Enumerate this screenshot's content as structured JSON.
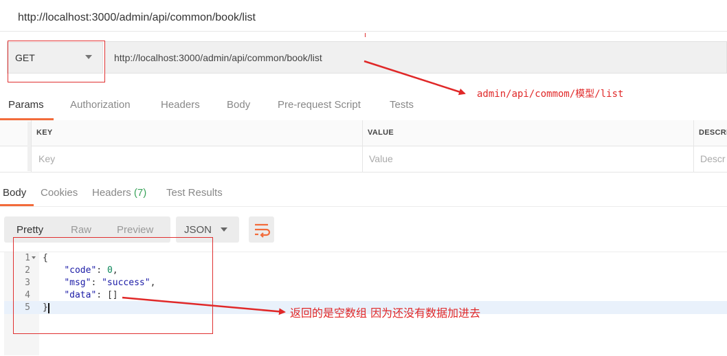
{
  "title": "http://localhost:3000/admin/api/common/book/list",
  "request": {
    "method": "GET",
    "url": "http://localhost:3000/admin/api/common/book/list"
  },
  "request_tabs": [
    {
      "label": "Params",
      "active": true
    },
    {
      "label": "Authorization"
    },
    {
      "label": "Headers"
    },
    {
      "label": "Body"
    },
    {
      "label": "Pre-request Script"
    },
    {
      "label": "Tests"
    }
  ],
  "params_table": {
    "headers": [
      "KEY",
      "VALUE",
      "DESCRI"
    ],
    "placeholders": [
      "Key",
      "Value",
      "Descr"
    ]
  },
  "response_tabs": {
    "body": "Body",
    "cookies": "Cookies",
    "headers": "Headers",
    "headers_count": "(7)",
    "test_results": "Test Results"
  },
  "view_modes": [
    "Pretty",
    "Raw",
    "Preview"
  ],
  "format": "JSON",
  "wrap_icon": "wrap-lines-icon",
  "code": {
    "line_numbers": [
      "1",
      "2",
      "3",
      "4",
      "5"
    ],
    "open_brace": "{",
    "close_brace": "}",
    "code_key": "\"code\"",
    "code_value": "0",
    "msg_key": "\"msg\"",
    "msg_value": "\"success\"",
    "data_key": "\"data\"",
    "data_value": "[]"
  },
  "annotations": {
    "url_note": "admin/api/commom/模型/list",
    "response_note": "返回的是空数组 因为还没有数据加进去"
  },
  "colors": {
    "accent": "#f26b3a",
    "annotation": "#e02828",
    "count": "#3aa35a"
  }
}
